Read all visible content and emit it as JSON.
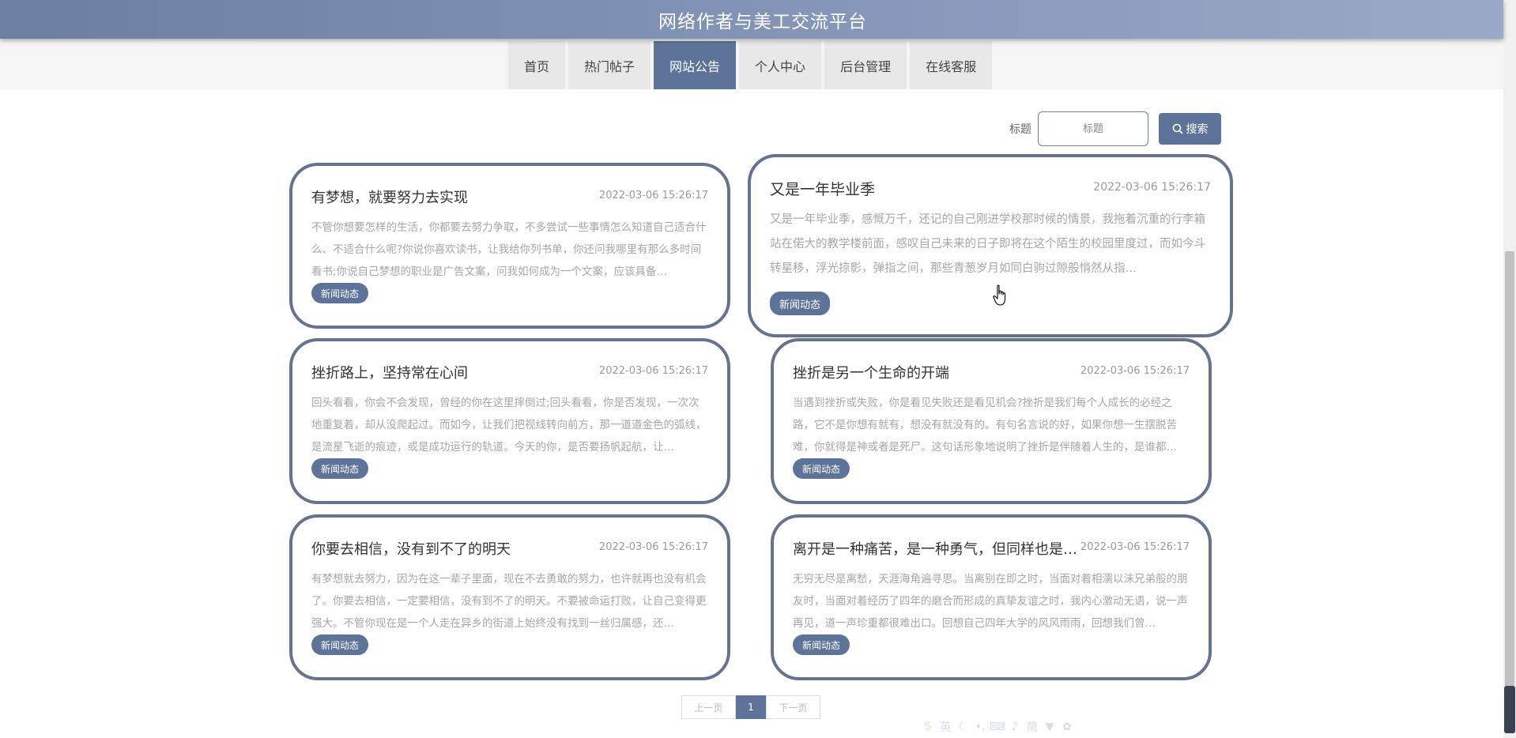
{
  "header": {
    "title": "网络作者与美工交流平台"
  },
  "nav": {
    "items": [
      {
        "label": "首页"
      },
      {
        "label": "热门帖子"
      },
      {
        "label": "网站公告"
      },
      {
        "label": "个人中心"
      },
      {
        "label": "后台管理"
      },
      {
        "label": "在线客服"
      }
    ],
    "active": "网站公告"
  },
  "search": {
    "label": "标题",
    "placeholder": "标题",
    "button_label": "搜索"
  },
  "cards": [
    {
      "title": "有梦想，就要努力去实现",
      "date": "2022-03-06 15:26:17",
      "text": "不管你想要怎样的生活，你都要去努力争取，不多尝试一些事情怎么知道自己适合什么、不适合什么呢?你说你喜欢读书，让我给你列书单，你还问我哪里有那么多时间看书;你说自己梦想的职业是广告文案，问我如何成为一个文案，应该具备…",
      "tag": "新闻动态"
    },
    {
      "title": "又是一年毕业季",
      "date": "2022-03-06 15:26:17",
      "text": "又是一年毕业季，感慨万千，还记的自己刚进学校那时候的情景，我拖着沉重的行李箱站在偌大的教学楼前面，感叹自己未来的日子即将在这个陌生的校园里度过，而如今斗转星移，浮光掠影，弹指之间，那些青葱岁月如同白驹过隙般悄然从指…",
      "tag": "新闻动态"
    },
    {
      "title": "挫折路上，坚持常在心间",
      "date": "2022-03-06 15:26:17",
      "text": "回头看看，你会不会发现，曾经的你在这里摔倒过;回头看看，你是否发现，一次次地重复着，却从没爬起过。而如今，让我们把视线转向前方，那一道道金色的弧线，是流星飞逝的痕迹，或是成功运行的轨道。今天的你，是否要扬帆起航，让…",
      "tag": "新闻动态"
    },
    {
      "title": "挫折是另一个生命的开端",
      "date": "2022-03-06 15:26:17",
      "text": "当遇到挫折或失败，你是看见失败还是看见机会?挫折是我们每个人成长的必经之路，它不是你想有就有，想没有就没有的。有句名言说的好，如果你想一生摆脱苦难，你就得是神或者是死尸。这句话形象地说明了挫折是伴随着人生的，是谁都…",
      "tag": "新闻动态"
    },
    {
      "title": "你要去相信，没有到不了的明天",
      "date": "2022-03-06 15:26:17",
      "text": "有梦想就去努力，因为在这一辈子里面，现在不去勇敢的努力，也许就再也没有机会了。你要去相信，一定要相信，没有到不了的明天。不要被命运打败，让自己变得更强大。不管你现在是一个人走在异乡的街道上始终没有找到一丝归属感，还…",
      "tag": "新闻动态"
    },
    {
      "title": "离开是一种痛苦，是一种勇气，但同样也是…",
      "date": "2022-03-06 15:26:17",
      "text": "无穷无尽是离愁，天涯海角遍寻思。当离别在即之时，当面对着相濡以沫兄弟般的朋友时，当面对着经历了四年的磨合而形成的真挚友谊之时，我内心激动无语，说一声再见，道一声珍重都很难出口。回想自己四年大学的风风雨雨，回想我们曾…",
      "tag": "新闻动态"
    }
  ],
  "pagination": {
    "prev_label": "上一页",
    "current_page": "1",
    "next_label": "下一页"
  },
  "colors": {
    "accent": "#5e739a",
    "card_border": "#65738f",
    "banner_start": "#6b7fa3",
    "banner_end": "#9aa9c7"
  },
  "toolbar_icons": [
    "sogou-icon",
    "lang-icon",
    "moon-icon",
    "punctuation-icon",
    "keyboard-icon",
    "mic-icon",
    "simplified-icon",
    "shirt-icon",
    "gear-icon"
  ],
  "toolbar_lang_label": "英",
  "toolbar_simplified_label": "简"
}
